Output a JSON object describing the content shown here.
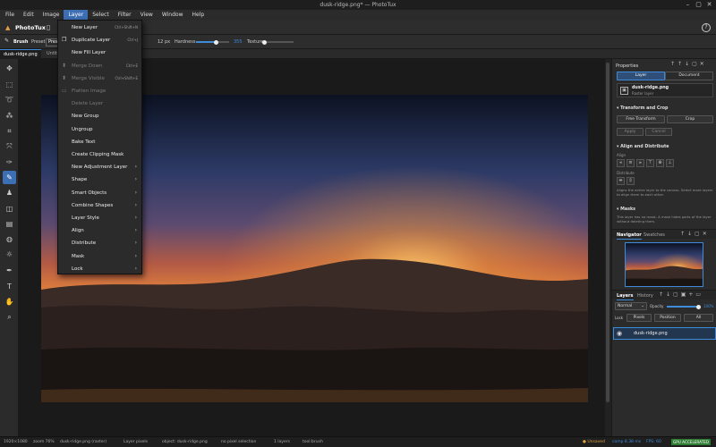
{
  "window": {
    "title": "dusk-ridge.png* — PhotoTux",
    "controls": [
      "–",
      "▢",
      "✕"
    ]
  },
  "menubar": [
    "File",
    "Edit",
    "Image",
    "Layer",
    "Select",
    "Filter",
    "View",
    "Window",
    "Help"
  ],
  "active_menu": "Layer",
  "app": {
    "name": "PhotoTux"
  },
  "options": {
    "tool_label": "Brush",
    "preset_label": "Preset",
    "preset_value": "Pres",
    "size_value": "12 px",
    "hardness_label": "Hardness",
    "hardness_value": "355",
    "texture_label": "Texture",
    "hardness_level": 0.6
  },
  "doc_tabs": [
    "dusk-ridge.png",
    "Untit"
  ],
  "layer_menu": [
    {
      "label": "New Layer",
      "shortcut": "Ctrl+Shift+N",
      "disabled": false,
      "submenu": false,
      "icon": ""
    },
    {
      "label": "Duplicate Layer",
      "shortcut": "Ctrl+J",
      "disabled": false,
      "submenu": false,
      "icon": "❐"
    },
    {
      "label": "New Fill Layer",
      "shortcut": "",
      "disabled": false,
      "submenu": false,
      "icon": ""
    },
    {
      "label": "Merge Down",
      "shortcut": "Ctrl+E",
      "disabled": true,
      "submenu": false,
      "icon": "⬍"
    },
    {
      "label": "Merge Visible",
      "shortcut": "Ctrl+Shift+E",
      "disabled": true,
      "submenu": false,
      "icon": "⬍"
    },
    {
      "label": "Flatten Image",
      "shortcut": "",
      "disabled": true,
      "submenu": false,
      "icon": "▭"
    },
    {
      "label": "Delete Layer",
      "shortcut": "",
      "disabled": true,
      "submenu": false,
      "icon": ""
    },
    {
      "label": "New Group",
      "shortcut": "",
      "disabled": false,
      "submenu": false,
      "icon": ""
    },
    {
      "label": "Ungroup",
      "shortcut": "",
      "disabled": false,
      "submenu": false,
      "icon": ""
    },
    {
      "label": "Bake Text",
      "shortcut": "",
      "disabled": false,
      "submenu": false,
      "icon": ""
    },
    {
      "label": "Create Clipping Mask",
      "shortcut": "",
      "disabled": false,
      "submenu": false,
      "icon": ""
    },
    {
      "label": "New Adjustment Layer",
      "shortcut": "",
      "disabled": false,
      "submenu": true,
      "icon": ""
    },
    {
      "label": "Shape",
      "shortcut": "",
      "disabled": false,
      "submenu": true,
      "icon": ""
    },
    {
      "label": "Smart Objects",
      "shortcut": "",
      "disabled": false,
      "submenu": true,
      "icon": ""
    },
    {
      "label": "Combine Shapes",
      "shortcut": "",
      "disabled": false,
      "submenu": true,
      "icon": ""
    },
    {
      "label": "Layer Style",
      "shortcut": "",
      "disabled": false,
      "submenu": true,
      "icon": ""
    },
    {
      "label": "Align",
      "shortcut": "",
      "disabled": false,
      "submenu": true,
      "icon": ""
    },
    {
      "label": "Distribute",
      "shortcut": "",
      "disabled": false,
      "submenu": true,
      "icon": ""
    },
    {
      "label": "Mask",
      "shortcut": "",
      "disabled": false,
      "submenu": true,
      "icon": ""
    },
    {
      "label": "Lock",
      "shortcut": "",
      "disabled": false,
      "submenu": true,
      "icon": ""
    }
  ],
  "properties": {
    "title": "Properties",
    "tabs": [
      "Layer",
      "Document"
    ],
    "layer_name": "dusk-ridge.png",
    "layer_type": "Raster layer",
    "transform_title": "Transform and Crop",
    "free_transform": "Free Transform",
    "crop": "Crop",
    "apply": "Apply",
    "cancel": "Cancel",
    "align_title": "Align and Distribute",
    "align_label": "Align",
    "distribute_label": "Distribute",
    "align_hint": "Aligns the active layer to the canvas. Select more layers to align them to each other.",
    "masks_title": "Masks",
    "masks_hint": "This layer has no mask. A mask hides parts of the layer without deleting them."
  },
  "navigator": {
    "tabs": [
      "Navigator",
      "Swatches"
    ]
  },
  "layers": {
    "tabs": [
      "Layers",
      "History"
    ],
    "blend_mode": "Normal",
    "opacity_label": "Opacity",
    "opacity_value": "100%",
    "opacity": 1.0,
    "lock_label": "Lock",
    "lock_buttons": [
      "Pixels",
      "Position",
      "All"
    ],
    "items": [
      {
        "name": "dusk-ridge.png",
        "visible": true
      }
    ]
  },
  "status": {
    "dims": "1920×1080",
    "zoom": "zoom 76%",
    "file": "dusk-ridge.png (raster)",
    "mode": "Layer pixels",
    "object": "object: dusk-ridge.png",
    "selection": "no pixel selection",
    "layers": "1 layers",
    "tool": "tool:brush",
    "unsaved": "Unsaved",
    "comp": "comp 8.38 ms",
    "fps": "FPS: 60",
    "gpu": "GPU ACCELERATED"
  },
  "colors": {
    "accent": "#3d6fb4",
    "gpu_badge": "#2e7d32",
    "unsaved": "#e0a040"
  }
}
